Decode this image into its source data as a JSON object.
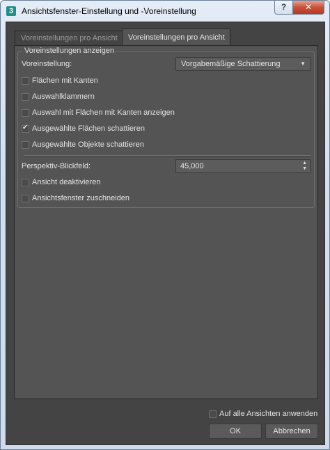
{
  "window": {
    "title": "Ansichtsfenster-Einstellung und -Voreinstellung",
    "app_icon_label": "3",
    "help_label": "?",
    "close_label": "✕"
  },
  "tabs": [
    {
      "label": "Voreinstellungen pro Ansicht",
      "active": false
    },
    {
      "label": "Voreinstellungen pro Ansicht",
      "active": true
    }
  ],
  "group": {
    "title": "Voreinstellungen anzeigen",
    "preset_label": "Voreinstellung:",
    "preset_value": "Vorgabemäßige Schattierung",
    "checkboxes": [
      {
        "label": "Flächen mit Kanten",
        "checked": false
      },
      {
        "label": "Auswahlklammern",
        "checked": false
      },
      {
        "label": "Auswahl mit Flächen mit Kanten anzeigen",
        "checked": false
      },
      {
        "label": "Ausgewählte Flächen schattieren",
        "checked": true
      },
      {
        "label": "Ausgewählte Objekte schattieren",
        "checked": false
      }
    ],
    "fov_label": "Perspektiv-Blickfeld:",
    "fov_value": "45,000",
    "checkboxes2": [
      {
        "label": "Ansicht deaktivieren",
        "checked": false
      },
      {
        "label": "Ansichtsfenster zuschneiden",
        "checked": false
      }
    ]
  },
  "footer": {
    "apply_all_label": "Auf alle Ansichten anwenden",
    "apply_all_checked": false,
    "ok_label": "OK",
    "cancel_label": "Abbrechen"
  },
  "colors": {
    "panel_bg": "#545454",
    "client_bg": "#444444",
    "text": "#e4e4e4"
  }
}
